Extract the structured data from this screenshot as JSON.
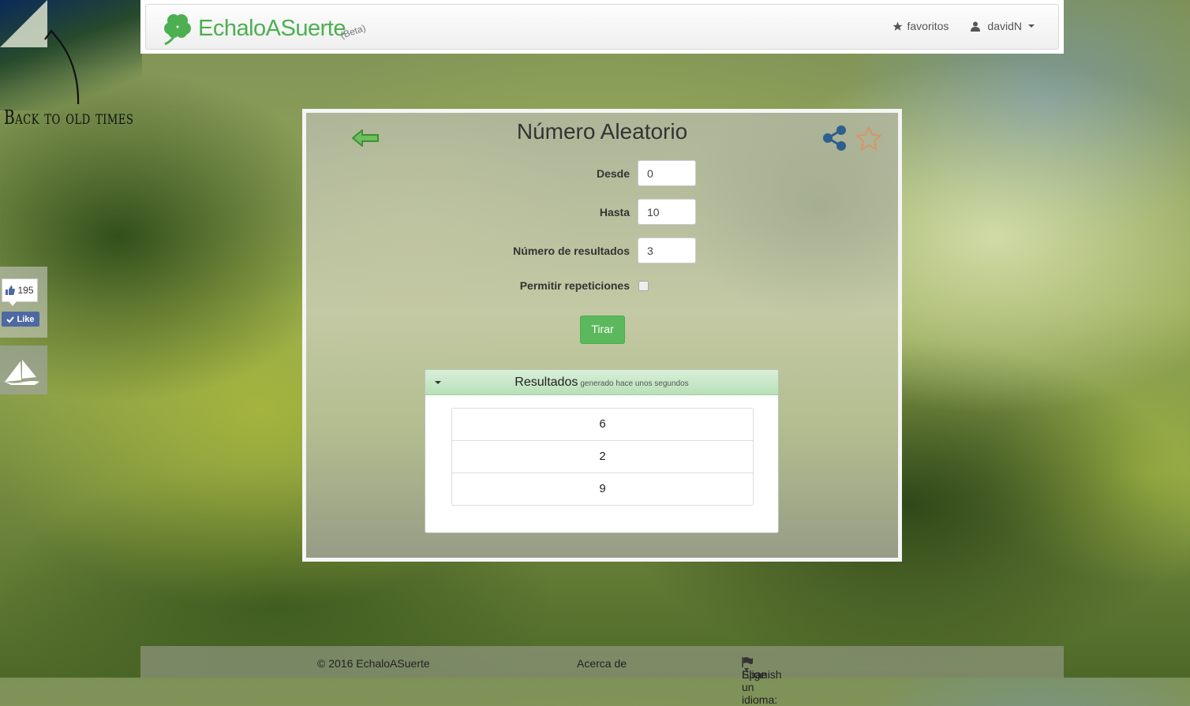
{
  "corner": {
    "back_text": "Back to old times"
  },
  "header": {
    "brand": "EchaloASuerte",
    "beta": "(Beta)",
    "favorites_label": "favoritos",
    "user_label": "davidN"
  },
  "panel": {
    "title": "Número Aleatorio",
    "form": {
      "desde_label": "Desde",
      "desde_value": "0",
      "hasta_label": "Hasta",
      "hasta_value": "10",
      "num_label": "Número de resultados",
      "num_value": "3",
      "repeat_label": "Permitir repeticiones",
      "repeat_checked": false
    },
    "submit_label": "Tirar",
    "results": {
      "title": "Resultados",
      "subtitle": "generado hace unos segundos",
      "values": [
        "6",
        "2",
        "9"
      ]
    }
  },
  "social": {
    "like_count": "195",
    "like_label": "Like"
  },
  "footer": {
    "copyright": "© 2016 EchaloASuerte",
    "about": "Acerca de",
    "lang_prompt": "Elige un idioma:",
    "lang_value": "Spanish"
  },
  "colors": {
    "brand_green": "#4caf50",
    "button_green": "#5cb85c",
    "share_blue": "#2d5f8f",
    "star_orange": "#d99466",
    "fb_blue": "#4e69a2"
  },
  "icons": [
    "clover-icon",
    "star-icon",
    "user-icon",
    "back-arrow-icon",
    "share-icon",
    "favorite-star-icon",
    "thumbs-up-icon",
    "check-icon",
    "ship-icon",
    "flag-icon"
  ]
}
